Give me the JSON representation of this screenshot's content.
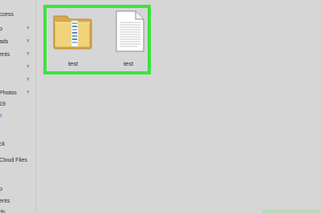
{
  "sidebar": {
    "items": [
      {
        "label": "ccess",
        "pinned": false
      },
      {
        "label": "p",
        "pinned": true
      },
      {
        "label": "ads",
        "pinned": true
      },
      {
        "label": "ents",
        "pinned": true
      },
      {
        "label": "",
        "pinned": true
      },
      {
        "label": "",
        "pinned": true
      },
      {
        "label": "Photos",
        "pinned": true
      },
      {
        "label": "19",
        "pinned": false
      },
      {
        "label": "s",
        "pinned": false
      },
      {
        "label": "",
        "pinned": false
      },
      {
        "label": "ck",
        "pinned": false
      },
      {
        "label": "",
        "pinned": false
      },
      {
        "label": "Cloud Files",
        "pinned": false
      },
      {
        "label": "",
        "pinned": false
      },
      {
        "label": "",
        "pinned": false
      },
      {
        "label": "p",
        "pinned": false
      },
      {
        "label": "ents",
        "pinned": false
      },
      {
        "label": "ds",
        "pinned": false
      }
    ]
  },
  "files": [
    {
      "name": "test",
      "type": "folder",
      "icon": "folder-icon"
    },
    {
      "name": "test",
      "type": "document",
      "icon": "document-icon"
    }
  ],
  "colors": {
    "background": "#d6d6d6",
    "highlight": "#39e53c",
    "folder": "#e8c25a",
    "accent_blue": "#3d6fb8"
  }
}
